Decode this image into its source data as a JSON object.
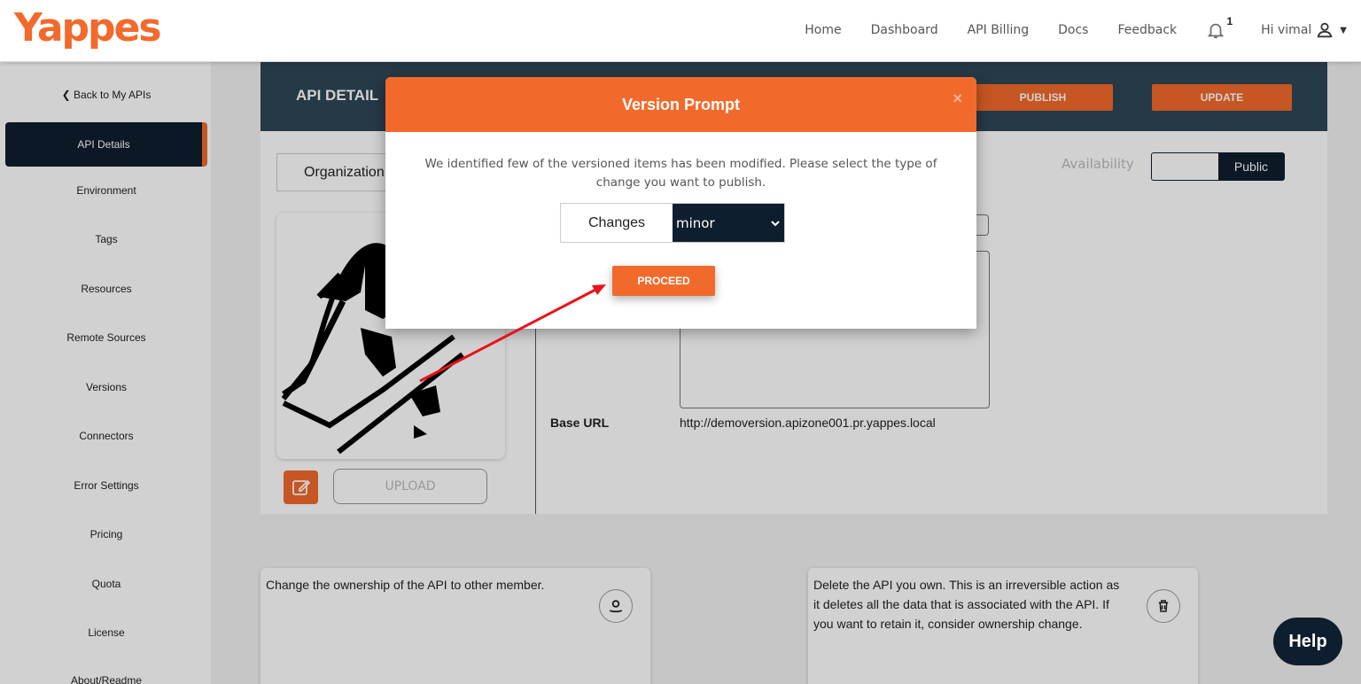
{
  "header": {
    "logo": "Yappes",
    "nav": [
      "Home",
      "Dashboard",
      "API Billing",
      "Docs",
      "Feedback"
    ],
    "notification_count": "1",
    "user_greeting": "Hi vimal"
  },
  "sidebar": {
    "back_link": "❮ Back to My APIs",
    "items": [
      "API Details",
      "Environment",
      "Tags",
      "Resources",
      "Remote Sources",
      "Versions",
      "Connectors",
      "Error Settings",
      "Pricing",
      "Quota",
      "License",
      "About/Readme"
    ],
    "active": "API Details"
  },
  "main": {
    "band_title": "API DETAIL",
    "publish_label": "PUBLISH",
    "update_label": "UPDATE",
    "organization_label": "Organization",
    "availability_label": "Availability",
    "availability_value": "Public",
    "upload_label": "UPLOAD",
    "base_url_label": "Base URL",
    "base_url_value": "http://demoversion.apizone001.pr.yappes.local",
    "ownership_text": "Change the ownership of the API to other member.",
    "delete_text": "Delete the API you own. This is an irreversible action as it deletes all the data that is associated with the API. If you want to retain it, consider ownership change."
  },
  "modal": {
    "title": "Version Prompt",
    "close": "×",
    "message": "We identified few of the versioned items has been modified. Please select the type of change you want to publish.",
    "changes_label": "Changes",
    "selected_change": "minor",
    "proceed_label": "PROCEED"
  },
  "help_label": "Help",
  "colors": {
    "accent": "#f26a2b",
    "navy": "#0f1e2e",
    "band": "#2f4656"
  }
}
